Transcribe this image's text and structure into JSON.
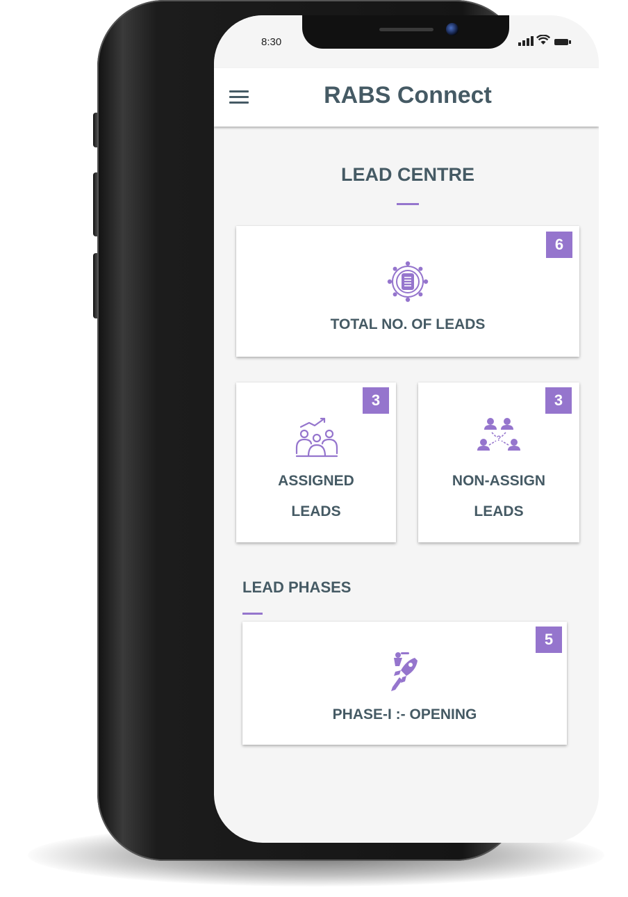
{
  "status_bar": {
    "time": "8:30"
  },
  "app_bar": {
    "title": "RABS Connect",
    "menu_icon": "hamburger-menu-icon"
  },
  "lead_centre": {
    "title": "LEAD CENTRE",
    "cards": {
      "total": {
        "label": "TOTAL NO. OF LEADS",
        "count": "6",
        "icon": "leads-network-icon"
      },
      "assigned": {
        "label_line1": "ASSIGNED",
        "label_line2": "LEADS",
        "count": "3",
        "icon": "team-growth-icon"
      },
      "non_assign": {
        "label_line1": "NON-ASSIGN",
        "label_line2": "LEADS",
        "count": "3",
        "icon": "unassigned-people-icon"
      }
    }
  },
  "lead_phases": {
    "title": "LEAD PHASES",
    "phases": [
      {
        "label": "PHASE-I :- OPENING",
        "count": "5",
        "icon": "rocket-launch-icon"
      }
    ]
  },
  "colors": {
    "accent": "#9575cd",
    "text": "#455a64",
    "background": "#f5f5f5",
    "card": "#ffffff"
  }
}
